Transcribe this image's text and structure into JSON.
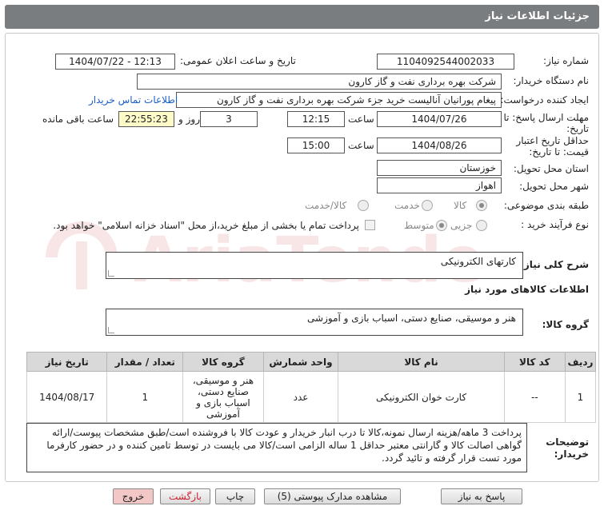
{
  "header": {
    "title": "جزئیات اطلاعات نیاز"
  },
  "form": {
    "need_number_label": "شماره نیاز:",
    "need_number": "1104092544002033",
    "announce_label": "تاریخ و ساعت اعلان عمومی:",
    "announce_value": "1404/07/22 - 12:13",
    "buyer_org_label": "نام دستگاه خریدار:",
    "buyer_org": "شرکت بهره برداری نفت و گاز کارون",
    "requester_label": "ایجاد کننده درخواست:",
    "requester": "پیغام پورانیان آنالیست خرید جزء شرکت بهره برداری نفت و گاز کارون",
    "contact_link": "اطلاعات تماس خریدار",
    "deadline_label": "مهلت ارسال پاسخ: تا تاریخ:",
    "deadline_date": "1404/07/26",
    "time_label": "ساعت",
    "deadline_time": "12:15",
    "days_value": "3",
    "days_label": "روز و",
    "remaining_time": "22:55:23",
    "remaining_label": "ساعت باقی مانده",
    "validity_label": "حداقل تاریخ اعتبار قیمت: تا تاریخ:",
    "validity_date": "1404/08/26",
    "validity_time": "15:00",
    "province_label": "استان محل تحویل:",
    "province": "خوزستان",
    "city_label": "شهر محل تحویل:",
    "city": "اهواز",
    "category_label": "طبقه بندی موضوعی:",
    "category_options": [
      "کالا",
      "خدمت",
      "کالا/خدمت"
    ],
    "process_label": "نوع فرآیند خرید :",
    "process_options": [
      "جزیی",
      "متوسط"
    ],
    "payment_note": "پرداخت تمام یا بخشی از مبلغ خرید،از محل \"اسناد خزانه اسلامی\" خواهد بود."
  },
  "summary": {
    "label": "شرح کلی نیاز:",
    "value": "کارتهای الکترونیکی"
  },
  "goods": {
    "section_title": "اطلاعات کالاهای مورد نیاز",
    "group_label": "گروه کالا:",
    "group_value": "هنر و موسیقی، صنایع دستی، اسباب بازی و آموزشی"
  },
  "table": {
    "headers": [
      "ردیف",
      "کد کالا",
      "نام کالا",
      "واحد شمارش",
      "گروه کالا",
      "تعداد / مقدار",
      "تاریخ نیاز"
    ],
    "rows": [
      [
        "1",
        "--",
        "کارت خوان الکترونیکی",
        "عدد",
        "هنر و موسیقی، صنایع دستی، اسباب بازی و آموزشی",
        "1",
        "1404/08/17"
      ]
    ]
  },
  "notes": {
    "label": "توضیحات خریدار:",
    "text": "پرداخت 3 ماهه/هزینه ارسال نمونه،کالا تا درب انبار خریدار و عودت کالا با فروشنده است/طبق مشخصات پیوست/ارائه گواهی اصالت کالا و گارانتی معتبر حداقل 1 ساله الزامی است/کالا می بایست در توسط تامین کننده و در حضور کارفرما مورد تست قرار گرفته و تائید گردد."
  },
  "buttons": {
    "reply": "پاسخ به نیاز",
    "attachments": "مشاهده مدارک پیوستی (5)",
    "print": "چاپ",
    "back": "بازگشت",
    "exit": "خروج"
  },
  "watermark": {
    "text": "AriaTender.net"
  }
}
